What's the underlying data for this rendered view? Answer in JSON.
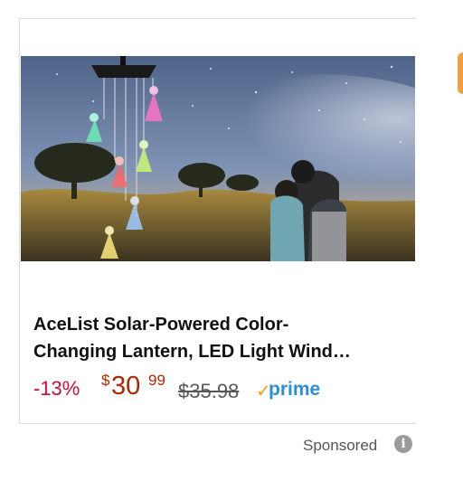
{
  "product": {
    "title_line1": "AceList Solar-Powered Color-",
    "title_line2": "Changing Lantern, LED Light Wind…",
    "discount": "-13%",
    "price_symbol": "$",
    "price_whole": "30",
    "price_fraction": "99",
    "list_price": "$35.98",
    "prime_check": "✓",
    "prime_label": "prime",
    "image_icon": "angel-wind-chime-photo"
  },
  "sponsored": {
    "label": "Sponsored",
    "info_icon": "info-icon",
    "info_glyph": "i"
  },
  "colors": {
    "price_red": "#b12704",
    "discount_red": "#cc0c39",
    "prime_blue": "#2a8fd6",
    "prime_check_orange": "#f7a20a",
    "list_price_gray": "#565959"
  }
}
